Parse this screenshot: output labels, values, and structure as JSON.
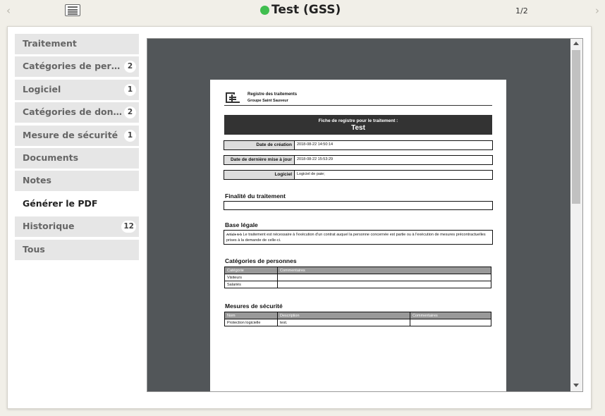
{
  "window": {
    "title": "Test (GSS)",
    "pager": "1/2",
    "status_color": "#3fbe4e"
  },
  "icons": {
    "prev": "chevron-left-icon",
    "next": "chevron-right-icon",
    "list": "list-icon",
    "logo": "register-logo-icon"
  },
  "sidebar": {
    "items": [
      {
        "label": "Traitement",
        "badge": ""
      },
      {
        "label": "Catégories de personnes",
        "badge": "2"
      },
      {
        "label": "Logiciel",
        "badge": "1"
      },
      {
        "label": "Catégories de données",
        "badge": "2"
      },
      {
        "label": "Mesure de sécurité",
        "badge": "1"
      },
      {
        "label": "Documents",
        "badge": ""
      },
      {
        "label": "Notes",
        "badge": ""
      },
      {
        "label": "Générer le PDF",
        "badge": ""
      },
      {
        "label": "Historique",
        "badge": "12"
      },
      {
        "label": "Tous",
        "badge": ""
      }
    ],
    "active_index": 7
  },
  "pdf": {
    "header_line1": "Registre des traitements",
    "header_line2": "Groupe Saint Sauveur",
    "banner_line1": "Fiche de registre pour le traitement :",
    "banner_line2": "Test",
    "fields": [
      {
        "label": "Date de création",
        "value": "2018-08-22 14:50:14"
      },
      {
        "label": "Date de dernière mise à jour",
        "value": "2018-08-22 15:53:29"
      },
      {
        "label": "Logiciel",
        "value": "Logiciel de paie;"
      }
    ],
    "finalite_title": "Finalité du traitement",
    "finalite_text": "",
    "base_title": "Base légale",
    "base_article": "Article 6-b",
    "base_text": "Le traitement est nécessaire à l'exécution d'un contrat auquel la personne concernée est partie ou à l'exécution de mesures précontractuelles prises à la demande de celle-ci.",
    "persons_title": "Catégories de personnes",
    "persons_headers": [
      "Catégorie",
      "Commentaires"
    ],
    "persons_rows": [
      [
        "Visiteurs",
        ""
      ],
      [
        "Salariés",
        ""
      ]
    ],
    "security_title": "Mesures de sécurité",
    "security_headers": [
      "Nom",
      "Description",
      "Commentaires"
    ],
    "security_rows": [
      [
        "Protection logicielle",
        "test.",
        ""
      ]
    ]
  }
}
